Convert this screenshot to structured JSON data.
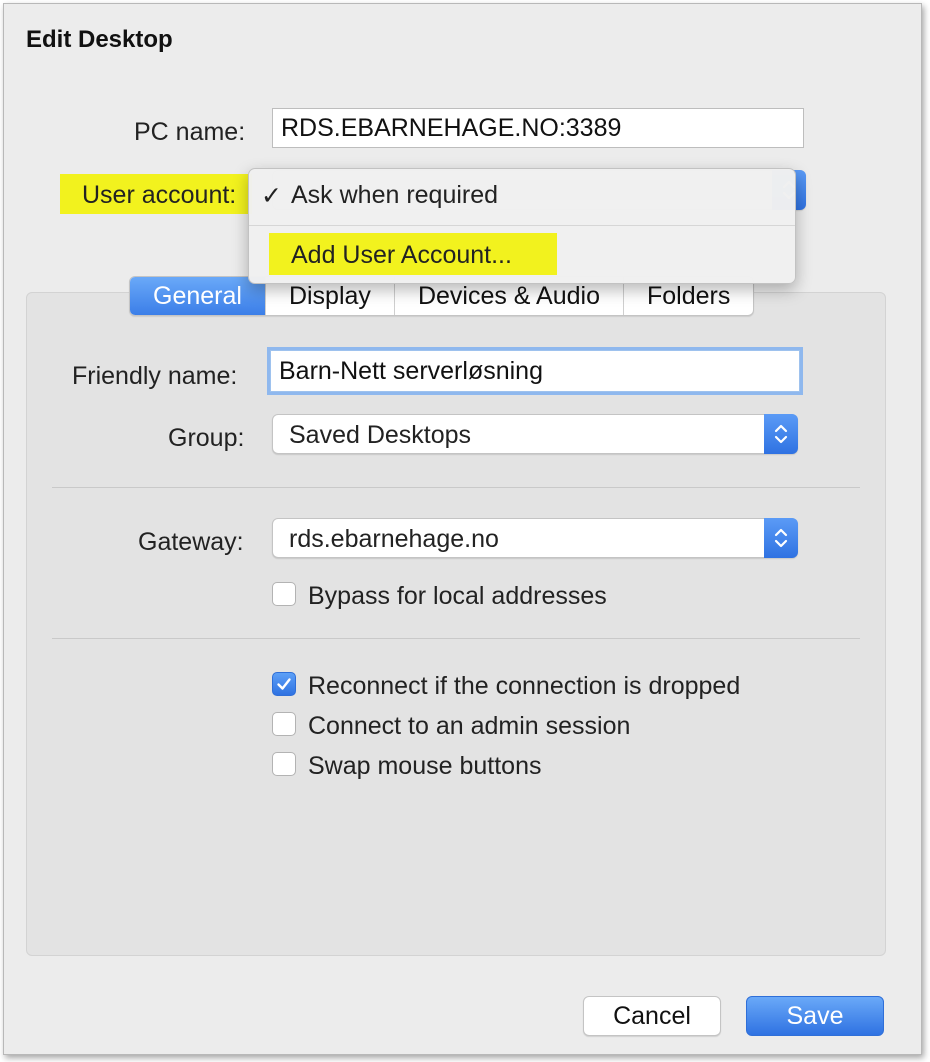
{
  "window": {
    "title": "Edit Desktop"
  },
  "form": {
    "pc_name_label": "PC name:",
    "pc_name_value": "RDS.EBARNEHAGE.NO:3389",
    "user_account_label": "User account:"
  },
  "user_account_menu": {
    "items": [
      {
        "label": "Ask when required",
        "checked": true
      },
      {
        "label": "Add User Account...",
        "checked": false
      }
    ]
  },
  "tabs": [
    {
      "label": "General",
      "active": true
    },
    {
      "label": "Display",
      "active": false
    },
    {
      "label": "Devices & Audio",
      "active": false
    },
    {
      "label": "Folders",
      "active": false
    }
  ],
  "general": {
    "friendly_name_label": "Friendly name:",
    "friendly_name_value": "Barn-Nett serverløsning",
    "group_label": "Group:",
    "group_value": "Saved Desktops",
    "gateway_label": "Gateway:",
    "gateway_value": "rds.ebarnehage.no",
    "options": [
      {
        "label": "Bypass for local addresses",
        "checked": false
      },
      {
        "label": "Reconnect if the connection is dropped",
        "checked": true
      },
      {
        "label": "Connect to an admin session",
        "checked": false
      },
      {
        "label": "Swap mouse buttons",
        "checked": false
      }
    ]
  },
  "buttons": {
    "cancel": "Cancel",
    "save": "Save"
  },
  "colors": {
    "accent": "#3b7ee8",
    "highlight": "#f2f21e"
  }
}
